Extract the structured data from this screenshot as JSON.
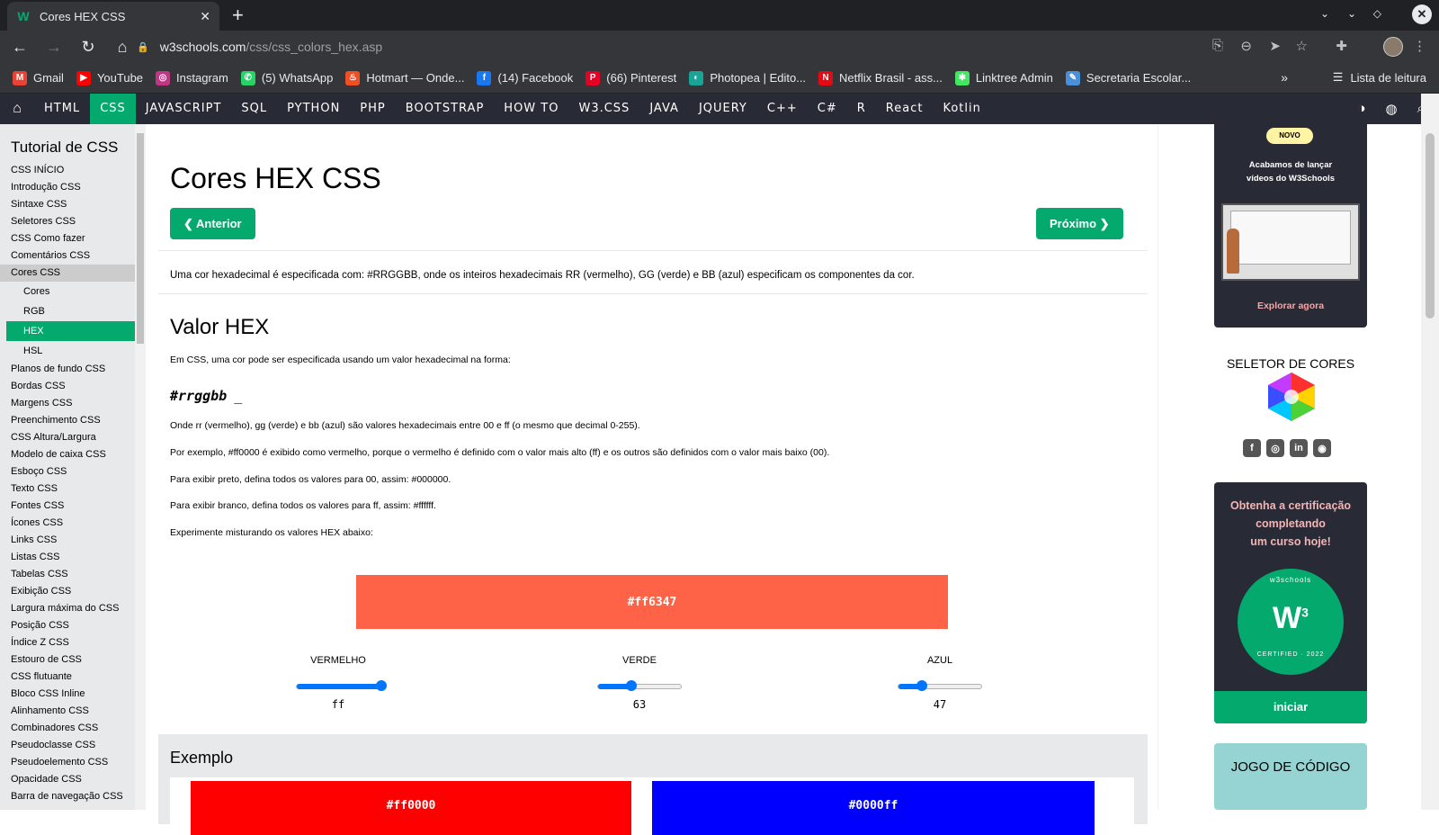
{
  "browser": {
    "tab_title": "Cores HEX CSS",
    "tab_close": "✕",
    "new_tab": "+",
    "url_host": "w3schools.com",
    "url_path": "/css/css_colors_hex.asp",
    "bookmarks": [
      {
        "label": "Gmail",
        "icon": "gmail-icon",
        "color": "#ea4335",
        "glyph": "M"
      },
      {
        "label": "YouTube",
        "icon": "youtube-icon",
        "color": "#ff0000",
        "glyph": "▶"
      },
      {
        "label": "Instagram",
        "icon": "instagram-icon",
        "color": "#c13584",
        "glyph": "◎"
      },
      {
        "label": "(5) WhatsApp",
        "icon": "whatsapp-icon",
        "color": "#25d366",
        "glyph": "✆"
      },
      {
        "label": "Hotmart — Onde...",
        "icon": "hotmart-icon",
        "color": "#f04e23",
        "glyph": "♨"
      },
      {
        "label": "(14) Facebook",
        "icon": "facebook-icon",
        "color": "#1877f2",
        "glyph": "f"
      },
      {
        "label": "(66) Pinterest",
        "icon": "pinterest-icon",
        "color": "#e60023",
        "glyph": "P"
      },
      {
        "label": "Photopea | Edito...",
        "icon": "photopea-icon",
        "color": "#18a497",
        "glyph": "◐"
      },
      {
        "label": "Netflix Brasil - ass...",
        "icon": "netflix-icon",
        "color": "#e50914",
        "glyph": "N"
      },
      {
        "label": "Linktree Admin",
        "icon": "linktree-icon",
        "color": "#43e660",
        "glyph": "✱"
      },
      {
        "label": "Secretaria Escolar...",
        "icon": "secretaria-icon",
        "color": "#4a90d9",
        "glyph": "✎"
      }
    ],
    "bookmarks_more": "»",
    "reading_list": "Lista de leitura"
  },
  "topnav": {
    "items": [
      "HTML",
      "CSS",
      "JAVASCRIPT",
      "SQL",
      "PYTHON",
      "PHP",
      "BOOTSTRAP",
      "HOW TO",
      "W3.CSS",
      "JAVA",
      "JQUERY",
      "C++",
      "C#",
      "R",
      "React",
      "Kotlin"
    ],
    "active": "CSS"
  },
  "sidebar": {
    "title": "Tutorial de CSS",
    "links_before": [
      "CSS INÍCIO",
      "Introdução CSS",
      "Sintaxe CSS",
      "Seletores CSS",
      "CSS Como fazer",
      "Comentários CSS"
    ],
    "open_section": "Cores CSS",
    "sub_items": [
      "Cores",
      "RGB",
      "HEX",
      "HSL"
    ],
    "active_sub": "HEX",
    "links_after": [
      "Planos de fundo CSS",
      "Bordas CSS",
      "Margens CSS",
      "Preenchimento CSS",
      "CSS Altura/Largura",
      "Modelo de caixa CSS",
      "Esboço CSS",
      "Texto CSS",
      "Fontes CSS",
      "Ícones CSS",
      "Links CSS",
      "Listas CSS",
      "Tabelas CSS",
      "Exibição CSS",
      "Largura máxima do CSS",
      "Posição CSS",
      "Índice Z CSS",
      "Estouro de CSS",
      "CSS flutuante",
      "Bloco CSS Inline",
      "Alinhamento CSS",
      "Combinadores CSS",
      "Pseudoclasse CSS",
      "Pseudoelemento CSS",
      "Opacidade CSS",
      "Barra de navegação CSS"
    ]
  },
  "main": {
    "title": "Cores HEX CSS",
    "prev_button": "❮ Anterior",
    "next_button": "Próximo ❯",
    "intro": "Uma cor hexadecimal é especificada com: #RRGGBB, onde os inteiros hexadecimais RR (vermelho), GG (verde) e BB (azul) especificam os componentes da cor.",
    "section_title": "Valor HEX",
    "p1": "Em CSS, uma cor pode ser especificada usando um valor hexadecimal na forma:",
    "code": "#rrggbb",
    "code_cursor": "_",
    "p2": "Onde rr (vermelho), gg (verde) e bb (azul) são valores hexadecimais entre 00 e ff (o mesmo que decimal 0-255).",
    "p3": "Por exemplo, #ff0000 é exibido como vermelho, porque o vermelho é definido com o valor mais alto (ff) e os outros são definidos com o valor mais baixo (00).",
    "p4": "Para exibir preto, defina todos os valores para 00, assim: #000000.",
    "p5": "Para exibir branco, defina todos os valores para ff, assim: #ffffff.",
    "p6": "Experimente misturando os valores HEX abaixo:",
    "color_box": {
      "text": "#ff6347",
      "color": "#ff6347"
    },
    "sliders": [
      {
        "label": "VERMELHO",
        "value": "ff",
        "fraction": 1.0
      },
      {
        "label": "VERDE",
        "value": "63",
        "fraction": 0.39
      },
      {
        "label": "AZUL",
        "value": "47",
        "fraction": 0.28
      }
    ],
    "example_title": "Exemplo",
    "example_swatches": [
      {
        "text": "#ff0000",
        "color": "#ff0000"
      },
      {
        "text": "#0000ff",
        "color": "#0000ff"
      }
    ]
  },
  "right": {
    "promo_badge": "NOVO",
    "promo_line1": "Acabamos de lançar",
    "promo_line2": "vídeos do W3Schools",
    "promo_link": "Explorar agora",
    "color_picker_title": "SELETOR DE CORES",
    "social_icons": [
      "facebook-icon",
      "instagram-icon",
      "linkedin-icon",
      "discord-icon"
    ],
    "cert_line1": "Obtenha a certificação",
    "cert_line2": "completando",
    "cert_line3": "um curso hoje!",
    "cert_badge_top": "w3schools",
    "cert_badge_bottom": "CERTIFIED · 2022",
    "cert_button": "iniciar",
    "game_title": "JOGO DE CÓDIGO"
  },
  "colors": {
    "accent": "#04aa6d",
    "nav_bg": "#282a35",
    "sidebar_bg": "#e7e9eb"
  }
}
